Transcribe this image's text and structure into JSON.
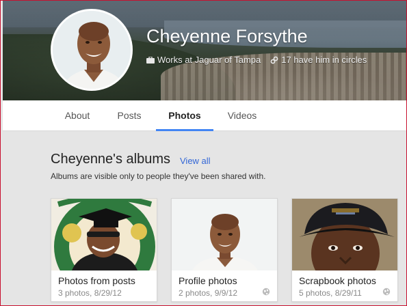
{
  "profile": {
    "name": "Cheyenne Forsythe",
    "work": "Works at Jaguar of Tampa",
    "circles": "17 have him in circles"
  },
  "tabs": [
    {
      "label": "About",
      "active": false
    },
    {
      "label": "Posts",
      "active": false
    },
    {
      "label": "Photos",
      "active": true
    },
    {
      "label": "Videos",
      "active": false
    }
  ],
  "albums": {
    "title": "Cheyenne's albums",
    "view_all": "View all",
    "subtitle": "Albums are visible only to people they've been shared with.",
    "items": [
      {
        "title": "Photos from posts",
        "meta": "3 photos, 8/29/12"
      },
      {
        "title": "Profile photos",
        "meta": "2 photos, 9/9/12"
      },
      {
        "title": "Scrapbook photos",
        "meta": "5 photos, 8/29/11"
      }
    ]
  },
  "colors": {
    "accent": "#4285f4",
    "link": "#3367d6",
    "frame": "#c8102e"
  },
  "icons": {
    "work": "briefcase-icon",
    "circles": "link-icon",
    "visibility": "globe-icon"
  }
}
